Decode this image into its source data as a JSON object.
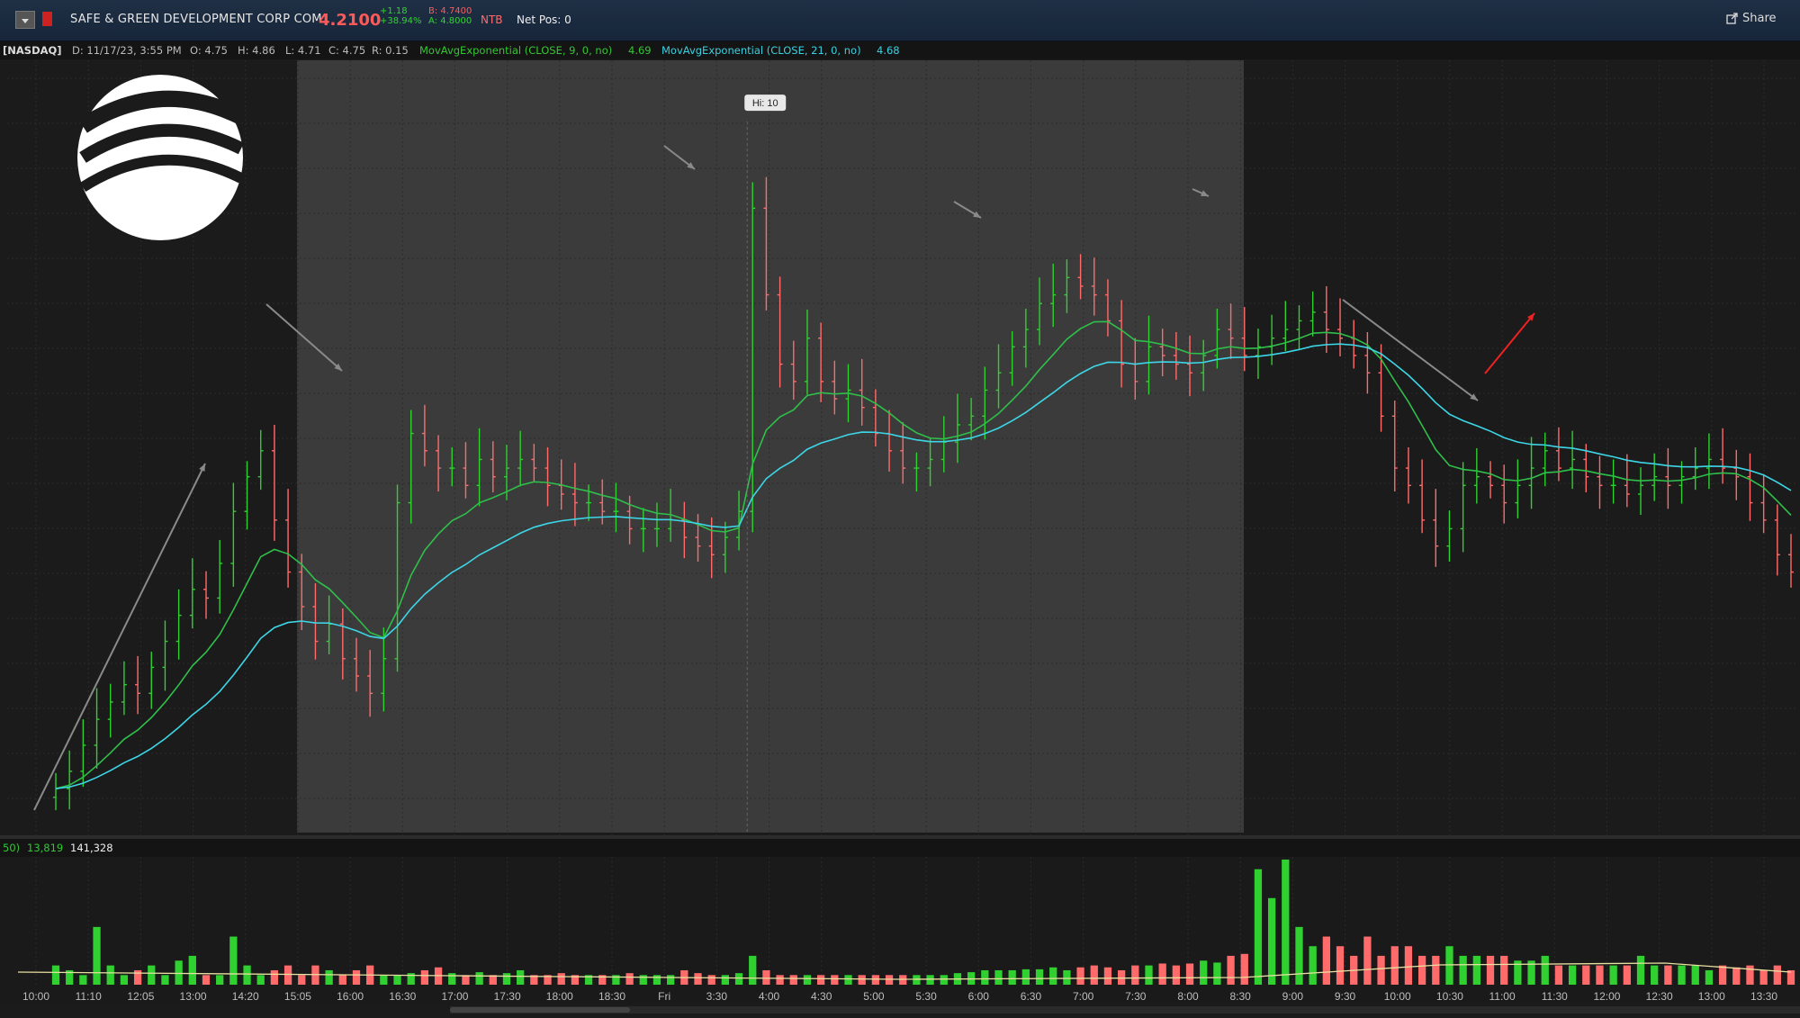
{
  "header": {
    "symbol_name": "SAFE & GREEN DEVELOPMENT CORP COM",
    "last_price": "4.2100",
    "change_abs": "+1.18",
    "change_pct": "+38.94%",
    "bid": "B: 4.7400",
    "ask": "A: 4.8000",
    "ntb": "NTB",
    "net_pos": "Net Pos: 0",
    "share_label": "Share"
  },
  "info": {
    "exchange": "[NASDAQ]",
    "date": "D: 11/17/23, 3:55 PM",
    "open": "O: 4.75",
    "high": "H: 4.86",
    "low": "L: 4.71",
    "close": "C: 4.75",
    "range": "R: 0.15",
    "ema9_label": "MovAvgExponential (CLOSE, 9, 0, no)",
    "ema9_value": "4.69",
    "ema21_label": "MovAvgExponential (CLOSE, 21, 0, no)",
    "ema21_value": "4.68"
  },
  "volume_info": {
    "a": "50)",
    "b": "13,819",
    "c": "141,328"
  },
  "hi_label": "Hi: 10",
  "colors": {
    "up": "#2fd02f",
    "down": "#ff6b6b",
    "ema9": "#2fbf4a",
    "ema21": "#3dd6e6",
    "session": "#3b3b3b",
    "bg": "#1b1b1b"
  },
  "chart_data": {
    "type": "candlestick",
    "x_tick_labels": [
      "10:00",
      "11:10",
      "12:05",
      "13:00",
      "14:20",
      "15:05",
      "16:00",
      "16:30",
      "17:00",
      "17:30",
      "18:00",
      "18:30",
      "Fri",
      "3:30",
      "4:00",
      "4:30",
      "5:00",
      "5:30",
      "6:00",
      "6:30",
      "7:00",
      "7:30",
      "8:00",
      "8:30",
      "9:00",
      "9:30",
      "10:00",
      "10:30",
      "11:00",
      "11:30",
      "12:00",
      "12:30",
      "13:00",
      "13:30"
    ],
    "price_range": [
      2.0,
      10.5
    ],
    "hi": 10,
    "close": [
      2.3,
      2.5,
      2.8,
      3.1,
      3.3,
      3.5,
      3.4,
      3.7,
      4.0,
      4.3,
      4.6,
      4.5,
      4.9,
      5.5,
      5.9,
      6.2,
      5.4,
      4.8,
      4.4,
      4.0,
      4.2,
      3.8,
      3.6,
      3.4,
      3.8,
      5.6,
      6.4,
      6.2,
      6.0,
      6.0,
      5.8,
      6.1,
      5.9,
      6.0,
      6.1,
      6.0,
      5.8,
      5.7,
      5.6,
      5.6,
      5.5,
      5.5,
      5.3,
      5.3,
      5.3,
      5.4,
      5.2,
      5.1,
      5.0,
      5.2,
      5.5,
      9.0,
      8.0,
      7.2,
      7.0,
      7.5,
      7.0,
      6.8,
      6.9,
      6.7,
      6.4,
      6.2,
      6.0,
      6.0,
      6.1,
      6.3,
      6.5,
      6.6,
      6.9,
      7.1,
      7.4,
      7.6,
      7.9,
      8.0,
      8.2,
      8.1,
      8.0,
      7.7,
      7.2,
      7.0,
      7.4,
      7.3,
      7.2,
      7.1,
      7.3,
      7.6,
      7.5,
      7.3,
      7.4,
      7.5,
      7.6,
      7.7,
      7.8,
      7.6,
      7.5,
      7.3,
      7.1,
      6.6,
      6.0,
      5.8,
      5.4,
      5.1,
      5.3,
      5.8,
      5.9,
      5.8,
      5.6,
      5.8,
      6.0,
      6.2,
      6.0,
      6.1,
      5.9,
      5.8,
      5.8,
      5.7,
      5.8,
      5.9,
      5.8,
      5.9,
      6.0,
      6.1,
      6.0,
      5.9,
      5.6,
      5.4,
      5.0,
      4.8
    ],
    "ema9_value": 4.69,
    "ema21_value": 4.68,
    "volume": {
      "values": [
        2,
        1.5,
        1,
        6,
        2,
        1,
        1.5,
        2,
        1,
        2.5,
        3,
        1,
        1,
        5,
        2,
        1,
        1.5,
        2,
        1,
        2,
        1.5,
        1,
        1.5,
        2,
        1,
        1,
        1.2,
        1.5,
        1.8,
        1.2,
        1,
        1.3,
        1,
        1.2,
        1.5,
        1,
        1,
        1.2,
        1,
        1,
        1,
        1,
        1.2,
        1,
        1,
        1,
        1.5,
        1.2,
        1,
        1,
        1.2,
        3,
        1.5,
        1,
        1,
        1,
        1,
        1,
        1,
        1,
        1,
        1,
        1,
        1,
        1,
        1,
        1.2,
        1.3,
        1.5,
        1.5,
        1.5,
        1.6,
        1.6,
        1.8,
        1.5,
        1.8,
        2,
        1.8,
        1.5,
        2,
        2,
        2.2,
        2,
        2.2,
        2.5,
        2.3,
        3,
        3.2,
        12,
        9,
        13,
        6,
        4,
        5,
        4,
        3,
        5,
        3,
        4,
        4,
        3,
        3,
        4,
        3,
        3,
        3,
        3,
        2.5,
        2.5,
        3,
        2,
        2,
        2,
        2,
        2,
        2,
        3,
        2,
        2,
        2,
        2,
        1.5,
        2,
        1.8,
        2,
        1.5,
        2,
        1.5
      ],
      "info_a": "50)",
      "info_b": "13,819",
      "info_c": "141,328"
    }
  }
}
